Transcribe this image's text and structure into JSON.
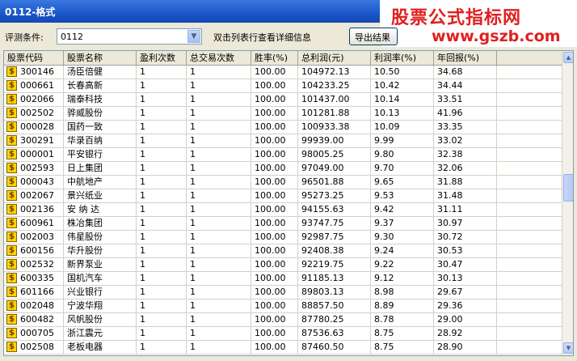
{
  "window": {
    "title": "0112-格式"
  },
  "watermark": {
    "line1": "股票公式指标网",
    "line2": "www.gszb.com"
  },
  "filter": {
    "label": "评测条件:",
    "value": "0112",
    "hint": "双击列表行查看详细信息",
    "export_label": "导出结果"
  },
  "table": {
    "columns": [
      "股票代码",
      "股票名称",
      "盈利次数",
      "总交易次数",
      "胜率(%)",
      "总利润(元)",
      "利润率(%)",
      "年回报(%)"
    ],
    "rows": [
      [
        "300146",
        "汤臣倍健",
        "1",
        "1",
        "100.00",
        "104972.13",
        "10.50",
        "34.68"
      ],
      [
        "000661",
        "长春高新",
        "1",
        "1",
        "100.00",
        "104233.25",
        "10.42",
        "34.44"
      ],
      [
        "002066",
        "瑞泰科技",
        "1",
        "1",
        "100.00",
        "101437.00",
        "10.14",
        "33.51"
      ],
      [
        "002502",
        "骅威股份",
        "1",
        "1",
        "100.00",
        "101281.88",
        "10.13",
        "41.96"
      ],
      [
        "000028",
        "国药一致",
        "1",
        "1",
        "100.00",
        "100933.38",
        "10.09",
        "33.35"
      ],
      [
        "300291",
        "华录百纳",
        "1",
        "1",
        "100.00",
        "99939.00",
        "9.99",
        "33.02"
      ],
      [
        "000001",
        "平安银行",
        "1",
        "1",
        "100.00",
        "98005.25",
        "9.80",
        "32.38"
      ],
      [
        "002593",
        "日上集团",
        "1",
        "1",
        "100.00",
        "97049.00",
        "9.70",
        "32.06"
      ],
      [
        "000043",
        "中航地产",
        "1",
        "1",
        "100.00",
        "96501.88",
        "9.65",
        "31.88"
      ],
      [
        "002067",
        "景兴纸业",
        "1",
        "1",
        "100.00",
        "95273.25",
        "9.53",
        "31.48"
      ],
      [
        "002136",
        "安 纳 达",
        "1",
        "1",
        "100.00",
        "94155.63",
        "9.42",
        "31.11"
      ],
      [
        "600961",
        "株冶集团",
        "1",
        "1",
        "100.00",
        "93747.75",
        "9.37",
        "30.97"
      ],
      [
        "002003",
        "伟星股份",
        "1",
        "1",
        "100.00",
        "92987.75",
        "9.30",
        "30.72"
      ],
      [
        "600156",
        "华升股份",
        "1",
        "1",
        "100.00",
        "92408.38",
        "9.24",
        "30.53"
      ],
      [
        "002532",
        "新界泵业",
        "1",
        "1",
        "100.00",
        "92219.75",
        "9.22",
        "30.47"
      ],
      [
        "600335",
        "国机汽车",
        "1",
        "1",
        "100.00",
        "91185.13",
        "9.12",
        "30.13"
      ],
      [
        "601166",
        "兴业银行",
        "1",
        "1",
        "100.00",
        "89803.13",
        "8.98",
        "29.67"
      ],
      [
        "002048",
        "宁波华翔",
        "1",
        "1",
        "100.00",
        "88857.50",
        "8.89",
        "29.36"
      ],
      [
        "600482",
        "风帆股份",
        "1",
        "1",
        "100.00",
        "87780.25",
        "8.78",
        "29.00"
      ],
      [
        "000705",
        "浙江震元",
        "1",
        "1",
        "100.00",
        "87536.63",
        "8.75",
        "28.92"
      ],
      [
        "002508",
        "老板电器",
        "1",
        "1",
        "100.00",
        "87460.50",
        "8.75",
        "28.90"
      ]
    ]
  },
  "icons": {
    "stock": "dollar-stock-icon",
    "dropdown": "chevron-down-icon"
  },
  "colors": {
    "title_bar": "#1a55c8",
    "watermark_text": "#e02020",
    "stock_icon": "#ffd400"
  }
}
